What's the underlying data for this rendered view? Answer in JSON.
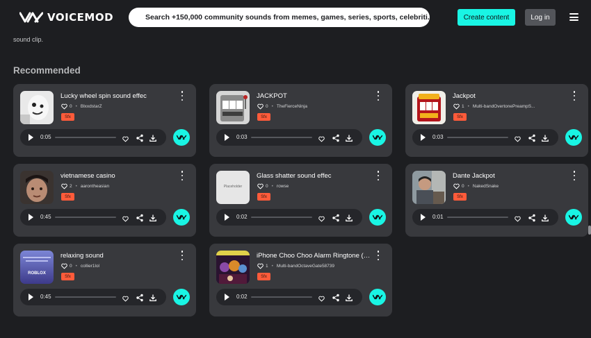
{
  "brand": {
    "name": "VOICEMOD",
    "accent": "#19f5e4",
    "tag_color": "#ff5b3a"
  },
  "header": {
    "search_placeholder": "Search +150,000 community sounds from memes, games, series, sports, celebriti...",
    "create_label": "Create content",
    "login_label": "Log in",
    "icons": [
      "voicemod-logo-icon",
      "search-icon",
      "hamburger-menu-icon"
    ]
  },
  "intro_text": "sound clip.",
  "section_title": "Recommended",
  "cards": [
    {
      "title": "Lucky wheel spin sound effec",
      "likes": "0",
      "author": "BlxxdstarZ",
      "tag": "Sfx",
      "time": "0:05",
      "thumb": "ghost"
    },
    {
      "title": "JACKPOT",
      "likes": "0",
      "author": "TheFierceNinja",
      "tag": "Sfx",
      "time": "0:03",
      "thumb": "slot-gray"
    },
    {
      "title": "Jackpot",
      "likes": "1",
      "author": "Multi-bandOvertonePreampS...",
      "tag": "Sfx",
      "time": "0:03",
      "thumb": "slot-red"
    },
    {
      "title": "vietnamese casino",
      "likes": "2",
      "author": "aarontheasian",
      "tag": "Sfx",
      "time": "0:45",
      "thumb": "face-dark"
    },
    {
      "title": "Glass shatter sound effec",
      "likes": "0",
      "author": "rowse",
      "tag": "Sfx",
      "time": "0:02",
      "thumb": "placeholder",
      "placeholder_text": "Placeholder"
    },
    {
      "title": "Dante Jackpot",
      "likes": "0",
      "author": "NakedSnake",
      "tag": "Sfx",
      "time": "0:01",
      "thumb": "person"
    },
    {
      "title": "relaxing sound",
      "likes": "0",
      "author": "collier1lol",
      "tag": "Sfx",
      "time": "0:45",
      "thumb": "roblox",
      "thumb_text": "ROBLOX"
    },
    {
      "title": "iPhone Choo Choo Alarm Ringtone (A...",
      "likes": "1",
      "author": "Multi-bandOctaveGate58739",
      "tag": "Sfx",
      "time": "0:02",
      "thumb": "poster"
    }
  ],
  "card_icons": [
    "heart-icon",
    "more-vertical-icon",
    "play-icon",
    "heart-outline-icon",
    "share-icon",
    "download-icon",
    "voicemod-button-icon"
  ]
}
